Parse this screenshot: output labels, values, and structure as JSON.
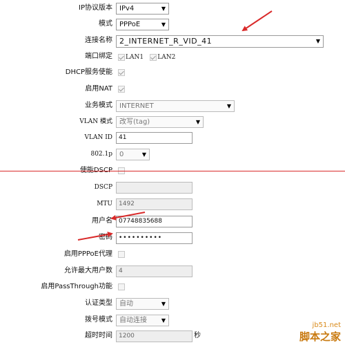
{
  "form": {
    "ip_version": {
      "label": "IP协议版本",
      "value": "IPv4"
    },
    "mode": {
      "label": "模式",
      "value": "PPPoE"
    },
    "connection_name": {
      "label": "连接名称",
      "value": "2_INTERNET_R_VID_41"
    },
    "port_binding": {
      "label": "端口绑定",
      "lan1": "LAN1",
      "lan2": "LAN2"
    },
    "dhcp_service": {
      "label": "DHCP服务使能"
    },
    "nat": {
      "label": "启用NAT"
    },
    "service_mode": {
      "label": "业务模式",
      "value": "INTERNET"
    },
    "vlan_mode": {
      "label": "VLAN 模式",
      "value": "改写(tag)"
    },
    "vlan_id": {
      "label": "VLAN ID",
      "value": "41"
    },
    "priority_8021p": {
      "label": "802.1p",
      "value": "0"
    },
    "enable_dscp": {
      "label": "使能DSCP"
    },
    "dscp": {
      "label": "DSCP",
      "value": ""
    },
    "mtu": {
      "label": "MTU",
      "value": "1492"
    },
    "username": {
      "label": "用户名",
      "value": "07748835688"
    },
    "password": {
      "label": "密码",
      "value": "••••••••••"
    },
    "pppoe_proxy": {
      "label": "启用PPPoE代理"
    },
    "max_users": {
      "label": "允许最大用户数",
      "value": "4"
    },
    "passthrough": {
      "label": "启用PassThrough功能"
    },
    "auth_type": {
      "label": "认证类型",
      "value": "自动"
    },
    "dial_mode": {
      "label": "拨号模式",
      "value": "自动连接"
    },
    "timeout": {
      "label": "超时时间",
      "value": "1200",
      "unit": "秒"
    }
  },
  "watermark": {
    "site": "jb51.net",
    "name": "脚本之家"
  },
  "colors": {
    "annotation_red": "#d92a2a"
  }
}
